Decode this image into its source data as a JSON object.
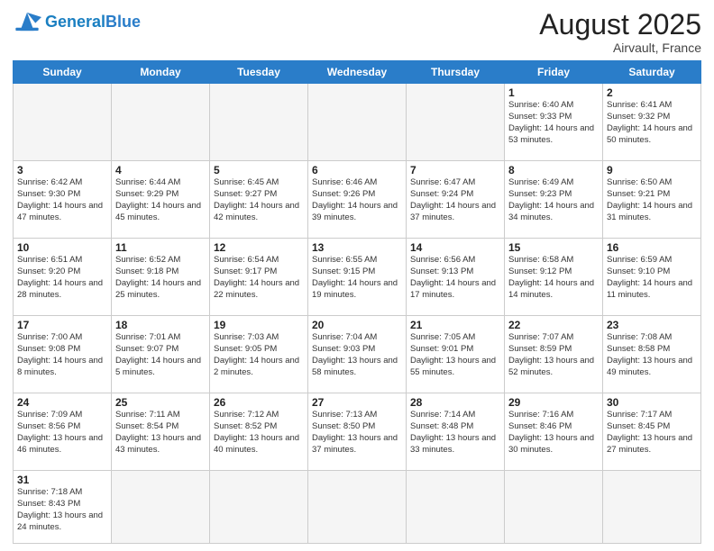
{
  "header": {
    "logo_general": "General",
    "logo_blue": "Blue",
    "month_year": "August 2025",
    "location": "Airvault, France"
  },
  "weekdays": [
    "Sunday",
    "Monday",
    "Tuesday",
    "Wednesday",
    "Thursday",
    "Friday",
    "Saturday"
  ],
  "weeks": [
    [
      {
        "day": "",
        "info": ""
      },
      {
        "day": "",
        "info": ""
      },
      {
        "day": "",
        "info": ""
      },
      {
        "day": "",
        "info": ""
      },
      {
        "day": "",
        "info": ""
      },
      {
        "day": "1",
        "info": "Sunrise: 6:40 AM\nSunset: 9:33 PM\nDaylight: 14 hours and 53 minutes."
      },
      {
        "day": "2",
        "info": "Sunrise: 6:41 AM\nSunset: 9:32 PM\nDaylight: 14 hours and 50 minutes."
      }
    ],
    [
      {
        "day": "3",
        "info": "Sunrise: 6:42 AM\nSunset: 9:30 PM\nDaylight: 14 hours and 47 minutes."
      },
      {
        "day": "4",
        "info": "Sunrise: 6:44 AM\nSunset: 9:29 PM\nDaylight: 14 hours and 45 minutes."
      },
      {
        "day": "5",
        "info": "Sunrise: 6:45 AM\nSunset: 9:27 PM\nDaylight: 14 hours and 42 minutes."
      },
      {
        "day": "6",
        "info": "Sunrise: 6:46 AM\nSunset: 9:26 PM\nDaylight: 14 hours and 39 minutes."
      },
      {
        "day": "7",
        "info": "Sunrise: 6:47 AM\nSunset: 9:24 PM\nDaylight: 14 hours and 37 minutes."
      },
      {
        "day": "8",
        "info": "Sunrise: 6:49 AM\nSunset: 9:23 PM\nDaylight: 14 hours and 34 minutes."
      },
      {
        "day": "9",
        "info": "Sunrise: 6:50 AM\nSunset: 9:21 PM\nDaylight: 14 hours and 31 minutes."
      }
    ],
    [
      {
        "day": "10",
        "info": "Sunrise: 6:51 AM\nSunset: 9:20 PM\nDaylight: 14 hours and 28 minutes."
      },
      {
        "day": "11",
        "info": "Sunrise: 6:52 AM\nSunset: 9:18 PM\nDaylight: 14 hours and 25 minutes."
      },
      {
        "day": "12",
        "info": "Sunrise: 6:54 AM\nSunset: 9:17 PM\nDaylight: 14 hours and 22 minutes."
      },
      {
        "day": "13",
        "info": "Sunrise: 6:55 AM\nSunset: 9:15 PM\nDaylight: 14 hours and 19 minutes."
      },
      {
        "day": "14",
        "info": "Sunrise: 6:56 AM\nSunset: 9:13 PM\nDaylight: 14 hours and 17 minutes."
      },
      {
        "day": "15",
        "info": "Sunrise: 6:58 AM\nSunset: 9:12 PM\nDaylight: 14 hours and 14 minutes."
      },
      {
        "day": "16",
        "info": "Sunrise: 6:59 AM\nSunset: 9:10 PM\nDaylight: 14 hours and 11 minutes."
      }
    ],
    [
      {
        "day": "17",
        "info": "Sunrise: 7:00 AM\nSunset: 9:08 PM\nDaylight: 14 hours and 8 minutes."
      },
      {
        "day": "18",
        "info": "Sunrise: 7:01 AM\nSunset: 9:07 PM\nDaylight: 14 hours and 5 minutes."
      },
      {
        "day": "19",
        "info": "Sunrise: 7:03 AM\nSunset: 9:05 PM\nDaylight: 14 hours and 2 minutes."
      },
      {
        "day": "20",
        "info": "Sunrise: 7:04 AM\nSunset: 9:03 PM\nDaylight: 13 hours and 58 minutes."
      },
      {
        "day": "21",
        "info": "Sunrise: 7:05 AM\nSunset: 9:01 PM\nDaylight: 13 hours and 55 minutes."
      },
      {
        "day": "22",
        "info": "Sunrise: 7:07 AM\nSunset: 8:59 PM\nDaylight: 13 hours and 52 minutes."
      },
      {
        "day": "23",
        "info": "Sunrise: 7:08 AM\nSunset: 8:58 PM\nDaylight: 13 hours and 49 minutes."
      }
    ],
    [
      {
        "day": "24",
        "info": "Sunrise: 7:09 AM\nSunset: 8:56 PM\nDaylight: 13 hours and 46 minutes."
      },
      {
        "day": "25",
        "info": "Sunrise: 7:11 AM\nSunset: 8:54 PM\nDaylight: 13 hours and 43 minutes."
      },
      {
        "day": "26",
        "info": "Sunrise: 7:12 AM\nSunset: 8:52 PM\nDaylight: 13 hours and 40 minutes."
      },
      {
        "day": "27",
        "info": "Sunrise: 7:13 AM\nSunset: 8:50 PM\nDaylight: 13 hours and 37 minutes."
      },
      {
        "day": "28",
        "info": "Sunrise: 7:14 AM\nSunset: 8:48 PM\nDaylight: 13 hours and 33 minutes."
      },
      {
        "day": "29",
        "info": "Sunrise: 7:16 AM\nSunset: 8:46 PM\nDaylight: 13 hours and 30 minutes."
      },
      {
        "day": "30",
        "info": "Sunrise: 7:17 AM\nSunset: 8:45 PM\nDaylight: 13 hours and 27 minutes."
      }
    ],
    [
      {
        "day": "31",
        "info": "Sunrise: 7:18 AM\nSunset: 8:43 PM\nDaylight: 13 hours and 24 minutes."
      },
      {
        "day": "",
        "info": ""
      },
      {
        "day": "",
        "info": ""
      },
      {
        "day": "",
        "info": ""
      },
      {
        "day": "",
        "info": ""
      },
      {
        "day": "",
        "info": ""
      },
      {
        "day": "",
        "info": ""
      }
    ]
  ]
}
